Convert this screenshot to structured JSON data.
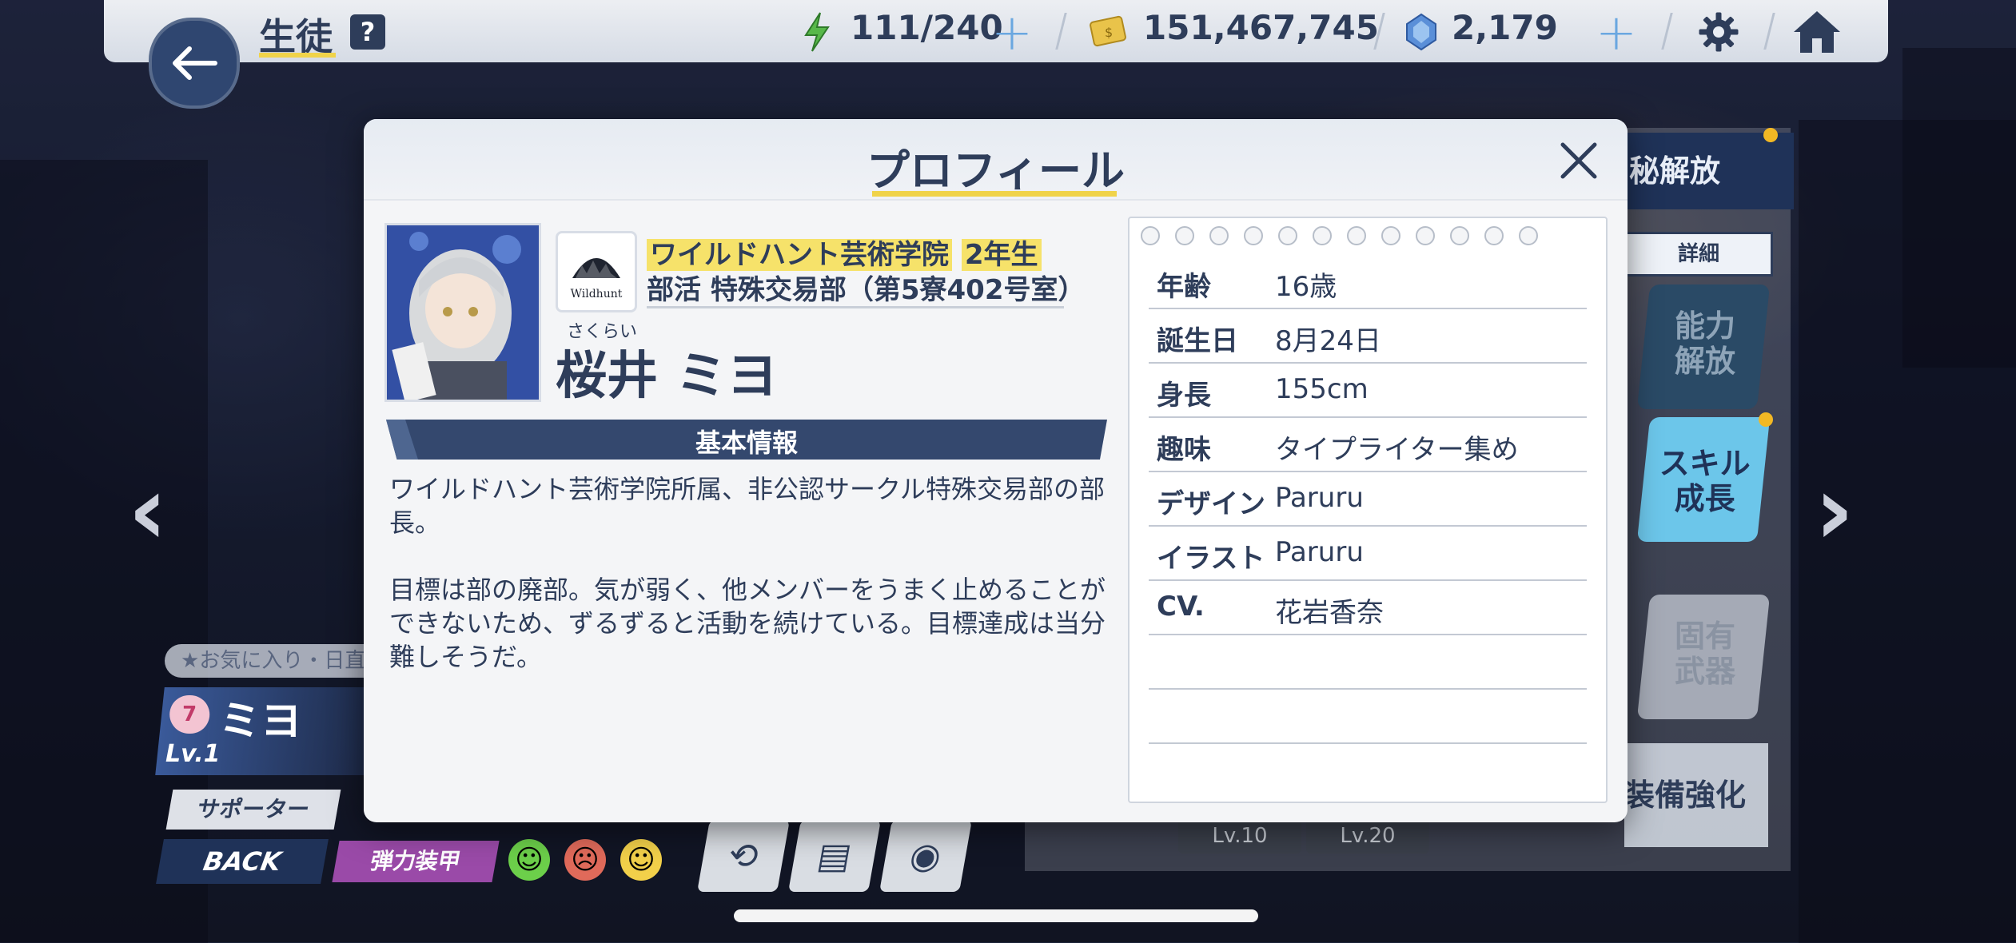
{
  "header": {
    "title": "生徒",
    "help_label": "?",
    "ap": "111/240",
    "credits": "151,467,745",
    "gems": "2,179"
  },
  "background": {
    "favorite_label": "お気に入り・日直",
    "student_name": "ミヨ",
    "bond_level": "7",
    "level": "Lv.1",
    "role": "サポーター",
    "back_label": "BACK",
    "armor_type": "弾力装甲",
    "armor_color": "#9a4aa8",
    "secret_tab": "秘解放",
    "detail_tab": "詳細",
    "tiles": [
      {
        "label": "能力\n解放"
      },
      {
        "label": "スキル\n成長"
      },
      {
        "label": "固有\n武器"
      }
    ],
    "equip_label": "装備強化",
    "level_tabs": [
      "Lv.10",
      "Lv.20"
    ]
  },
  "modal": {
    "title": "プロフィール",
    "school": "ワイルドハント芸術学院",
    "grade": "2年生",
    "club_label": "部活",
    "club": "特殊交易部（第5寮402号室）",
    "logo_text": "Wildhunt",
    "furigana": "さくらい",
    "name": "桜井 ミヨ",
    "section_title": "基本情報",
    "description": "ワイルドハント芸術学院所属、非公認サークル特殊交易部の部長。\n\n目標は部の廃部。気が弱く、他メンバーをうまく止めることができないため、ずるずると活動を続けている。目標達成は当分難しそうだ。",
    "info": [
      {
        "key": "年齢",
        "value": "16歳"
      },
      {
        "key": "誕生日",
        "value": "8月24日"
      },
      {
        "key": "身長",
        "value": "155cm"
      },
      {
        "key": "趣味",
        "value": "タイプライター集め"
      },
      {
        "key": "デザイン",
        "value": "Paruru"
      },
      {
        "key": "イラスト",
        "value": "Paruru"
      },
      {
        "key": "CV.",
        "value": "花岩香奈"
      }
    ]
  },
  "colors": {
    "navy": "#2e3d5a",
    "accent_yellow": "#f0d34a",
    "section_bar": "#34486e"
  }
}
